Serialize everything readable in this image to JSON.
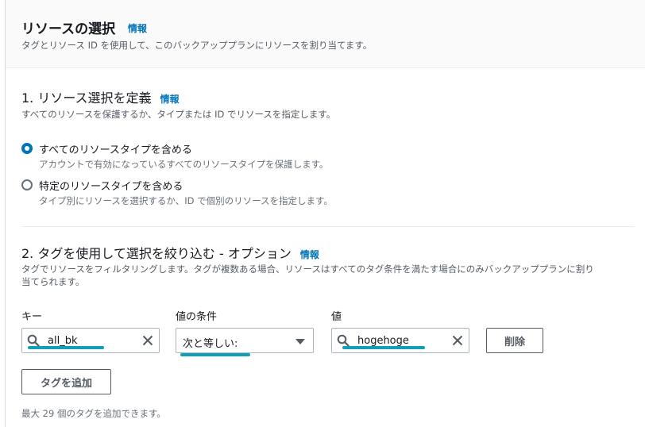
{
  "header": {
    "title": "リソースの選択",
    "info": "情報",
    "description": "タグとリソース ID を使用して、このバックアッププランにリソースを割り当てます。"
  },
  "section1": {
    "title": "1. リソース選択を定義",
    "info": "情報",
    "description": "すべてのリソースを保護するか、タイプまたは ID でリソースを指定します。",
    "options": [
      {
        "label": "すべてのリソースタイプを含める",
        "description": "アカウントで有効になっているすべてのリソースタイプを保護します。",
        "checked": true
      },
      {
        "label": "特定のリソースタイプを含める",
        "description": "タイプ別にリソースを選択するか、ID で個別のリソースを指定します。",
        "checked": false
      }
    ]
  },
  "section2": {
    "title": "2. タグを使用して選択を絞り込む - オプション",
    "info": "情報",
    "description_line1": "タグでリソースをフィルタリングします。タグが複数ある場合、リソースはすべてのタグ条件を満たす場合にのみバックアッププランに割り",
    "description_line2": "当てられます。",
    "key_label": "キー",
    "condition_label": "値の条件",
    "value_label": "値",
    "key_value": "all_bk",
    "condition_value": "次と等しい:",
    "value_value": "hogehoge",
    "delete_button": "削除",
    "add_tag_button": "タグを追加",
    "limit_note": "最大 29 個のタグを追加できます。"
  },
  "colors": {
    "accent": "#0073bb",
    "highlight_underline": "#0f9fb8"
  }
}
